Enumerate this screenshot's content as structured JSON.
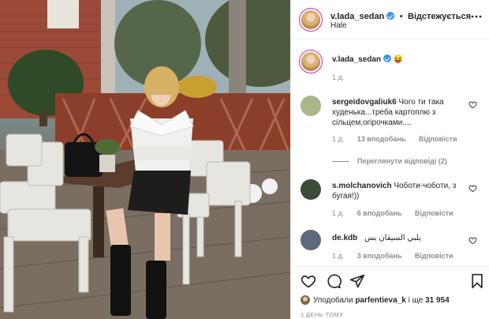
{
  "post": {
    "username": "v.lada_sedan",
    "follow_label": "Відстежується",
    "location": "Hale",
    "caption_emoji": "😝",
    "caption_time": "1 д."
  },
  "comments": [
    {
      "username": "sergeidovgaliuk6",
      "text": "Чого ти така худенька...треба картоплю з сільцем,огірочками....",
      "time": "1 д.",
      "likes": "13 вподобань",
      "reply": "Відповісти",
      "view_replies": "Переглянути відповіді (2)"
    },
    {
      "username": "s.molchanovich",
      "text": "Чоботи-чоботи, з бугая!))",
      "time": "1 д.",
      "likes": "6 вподобань",
      "reply": "Відповісти"
    },
    {
      "username": "de.kdb",
      "text": "يلبي السيقان بس",
      "time": "1 д.",
      "likes": "3 вподобань",
      "reply": "Відповісти"
    }
  ],
  "footer": {
    "liked_by_prefix": "Уподобали",
    "liked_by_user": "parfentieva_k",
    "liked_by_mid": "і ще",
    "liked_by_count": "31 954",
    "post_time": "1 ДЕНЬ ТОМУ"
  },
  "icons": {
    "more": "more-horizontal-icon",
    "verified": "verified-badge-icon",
    "heart": "heart-icon",
    "comment": "comment-icon",
    "share": "share-icon",
    "save": "bookmark-icon"
  },
  "colors": {
    "verified": "#3897f0",
    "muted": "#8e8e8e",
    "text": "#262626",
    "border": "#efefef"
  }
}
